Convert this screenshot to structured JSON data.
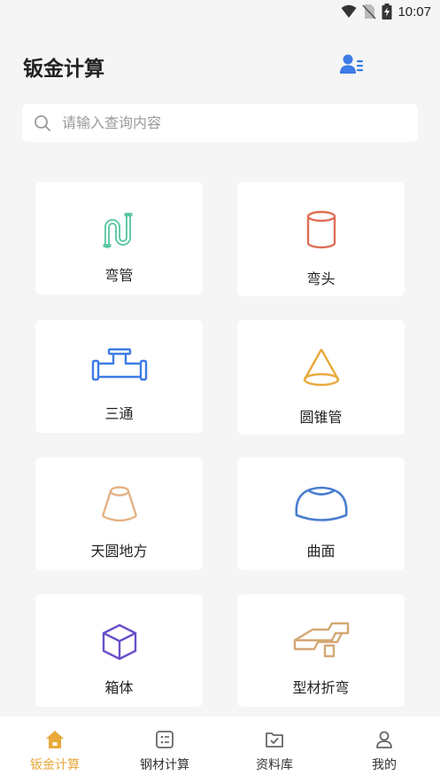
{
  "status_bar": {
    "time": "10:07"
  },
  "header": {
    "title": "钣金计算"
  },
  "search": {
    "placeholder": "请输入查询内容"
  },
  "tools": [
    {
      "label": "弯管",
      "icon": "bent-pipe-icon"
    },
    {
      "label": "弯头",
      "icon": "elbow-icon"
    },
    {
      "label": "三通",
      "icon": "tee-pipe-icon"
    },
    {
      "label": "圆锥管",
      "icon": "cone-pipe-icon"
    },
    {
      "label": "天圆地方",
      "icon": "round-to-square-icon"
    },
    {
      "label": "曲面",
      "icon": "curved-surface-icon"
    },
    {
      "label": "箱体",
      "icon": "box-icon"
    },
    {
      "label": "型材折弯",
      "icon": "profile-bend-icon"
    }
  ],
  "tabbar": {
    "tabs": [
      {
        "label": "钣金计算",
        "icon": "home-icon",
        "active": true
      },
      {
        "label": "钢材计算",
        "icon": "calculator-icon",
        "active": false
      },
      {
        "label": "资料库",
        "icon": "folder-check-icon",
        "active": false
      },
      {
        "label": "我的",
        "icon": "person-icon",
        "active": false
      }
    ]
  },
  "colors": {
    "accent": "#e8a93a",
    "profile_icon": "#3d7be6",
    "background": "#f5f5f5"
  }
}
